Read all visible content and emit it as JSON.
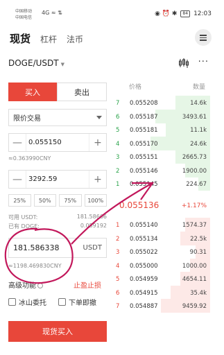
{
  "status_bar": {
    "carrier1": "中国移动",
    "carrier2": "中国电信",
    "signal": "4G ≈ ⇅ ",
    "right_icons": "◉ ⏰ ✱",
    "battery": "84",
    "time": "12:03"
  },
  "tabs": [
    {
      "label": "现货"
    },
    {
      "label": "杠杆"
    },
    {
      "label": "法币"
    }
  ],
  "pair": {
    "label": "DOGE/USDT",
    "caret": "▼"
  },
  "left": {
    "buy_label": "买入",
    "sell_label": "卖出",
    "order_type": "限价交易",
    "price": "0.055150",
    "price_cny": "≈0.363990CNY",
    "amount": "3292.59",
    "percents": [
      "25%",
      "50%",
      "75%",
      "100%"
    ],
    "avail_usdt_label": "可用 USDT:",
    "avail_usdt_value": "181.58666",
    "avail_doge_label": "已有 DOGE:",
    "avail_doge_value": "0.089192",
    "total_value": "181.586338",
    "total_unit": "USDT",
    "total_cny": "≈1198.469830CNY",
    "advanced_label": "高级功能",
    "stop_label": "止盈止损",
    "iceberg_label": "冰山委托",
    "fok_label": "下单即撤",
    "buy_button": "现货买入"
  },
  "orderbook": {
    "price_header": "价格",
    "qty_header": "数量",
    "asks": [
      {
        "n": "7",
        "price": "0.055208",
        "qty": "14.6k",
        "depth": 0.35
      },
      {
        "n": "6",
        "price": "0.055187",
        "qty": "3493.61",
        "depth": 0.55
      },
      {
        "n": "5",
        "price": "0.055181",
        "qty": "11.1k",
        "depth": 0.45
      },
      {
        "n": "4",
        "price": "0.055170",
        "qty": "24.6k",
        "depth": 0.6
      },
      {
        "n": "3",
        "price": "0.055151",
        "qty": "2665.73",
        "depth": 0.35
      },
      {
        "n": "2",
        "price": "0.055146",
        "qty": "1900.00",
        "depth": 0.25
      },
      {
        "n": "1",
        "price": "0.055145",
        "qty": "224.67",
        "depth": 0.12
      }
    ],
    "last_price": "0.055136",
    "change": "+1.17%",
    "bids": [
      {
        "n": "1",
        "price": "0.055140",
        "qty": "1574.37",
        "depth": 0.25
      },
      {
        "n": "2",
        "price": "0.055134",
        "qty": "22.5k",
        "depth": 0.3
      },
      {
        "n": "3",
        "price": "0.055022",
        "qty": "90.31",
        "depth": 0.15
      },
      {
        "n": "4",
        "price": "0.055000",
        "qty": "1000.00",
        "depth": 0.2
      },
      {
        "n": "5",
        "price": "0.054959",
        "qty": "4654.11",
        "depth": 0.3
      },
      {
        "n": "6",
        "price": "0.054915",
        "qty": "35.4k",
        "depth": 0.4
      },
      {
        "n": "7",
        "price": "0.054887",
        "qty": "9459.92",
        "depth": 0.5
      }
    ]
  },
  "colors": {
    "buy": "#e8473a",
    "sell_green": "#2aa34a",
    "annotation": "#c2185b"
  }
}
